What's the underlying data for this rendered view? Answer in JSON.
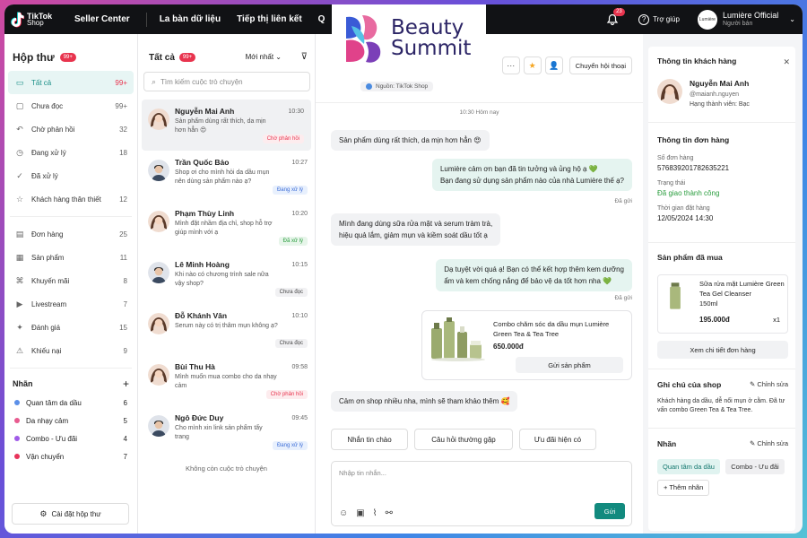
{
  "topbar": {
    "logo_name": "TikTok",
    "logo_sub": "Shop",
    "nav": [
      "Seller Center",
      "La bàn dữ liệu",
      "Tiếp thị liên kết",
      "Q"
    ],
    "notif_count": "23",
    "help_label": "Trợ giúp",
    "user_avatar_text": "Lumière",
    "user_name": "Lumière Official",
    "user_role": "Người bán"
  },
  "brand": {
    "line1": "Beauty",
    "line2": "Summit"
  },
  "sidebar": {
    "title": "Hộp thư",
    "badge": "99+",
    "items": [
      {
        "label": "Tất cả",
        "count": "99+",
        "icon": "inbox-icon"
      },
      {
        "label": "Chưa đọc",
        "count": "99+",
        "icon": "chat-icon"
      },
      {
        "label": "Chờ phản hồi",
        "count": "32",
        "icon": "reply-icon"
      },
      {
        "label": "Đang xử lý",
        "count": "18",
        "icon": "clock-icon"
      },
      {
        "label": "Đã xử lý",
        "count": "",
        "icon": "check-circle-icon"
      },
      {
        "label": "Khách hàng thân thiết",
        "count": "12",
        "icon": "star-icon"
      }
    ],
    "items2": [
      {
        "label": "Đơn hàng",
        "count": "25",
        "icon": "document-icon"
      },
      {
        "label": "Sản phẩm",
        "count": "11",
        "icon": "box-icon"
      },
      {
        "label": "Khuyến mãi",
        "count": "8",
        "icon": "tag-icon"
      },
      {
        "label": "Livestream",
        "count": "7",
        "icon": "video-icon"
      },
      {
        "label": "Đánh giá",
        "count": "15",
        "icon": "review-icon"
      },
      {
        "label": "Khiếu nại",
        "count": "9",
        "icon": "alert-icon"
      }
    ],
    "labels_title": "Nhãn",
    "labels": [
      {
        "label": "Quan tâm da dầu",
        "count": "6",
        "color": "#5b8fe8"
      },
      {
        "label": "Da nhạy cảm",
        "count": "5",
        "color": "#e85b8f"
      },
      {
        "label": "Combo - Ưu đãi",
        "count": "4",
        "color": "#a05be8"
      },
      {
        "label": "Vận chuyển",
        "count": "7",
        "color": "#e8345b"
      }
    ],
    "settings_label": "Cài đặt hộp thư"
  },
  "convlist": {
    "title": "Tất cả",
    "badge": "99+",
    "sort": "Mới nhất",
    "search_placeholder": "Tìm kiếm cuộc trò chuyện",
    "items": [
      {
        "name": "Nguyễn Mai Anh",
        "preview": "Sản phẩm dùng rất thích, da mịn hơn hẳn 😍",
        "time": "10:30",
        "status": "Chờ phản hồi",
        "tone": "red",
        "gender": "f"
      },
      {
        "name": "Trần Quốc Bảo",
        "preview": "Shop ơi cho mình hỏi da dầu mụn nên dùng sản phẩm nào ạ?",
        "time": "10:27",
        "status": "Đang xử lý",
        "tone": "blue",
        "gender": "m"
      },
      {
        "name": "Phạm Thùy Linh",
        "preview": "Mình đặt nhầm địa chỉ, shop hỗ trợ giúp mình với ạ",
        "time": "10:20",
        "status": "Đã xử lý",
        "tone": "green",
        "gender": "f"
      },
      {
        "name": "Lê Minh Hoàng",
        "preview": "Khi nào có chương trình sale nữa vậy shop?",
        "time": "10:15",
        "status": "Chưa đọc",
        "tone": "gray",
        "gender": "m"
      },
      {
        "name": "Đỗ Khánh Vân",
        "preview": "Serum này có trị thâm mụn không ạ?",
        "time": "10:10",
        "status": "Chưa đọc",
        "tone": "gray",
        "gender": "f"
      },
      {
        "name": "Bùi Thu Hà",
        "preview": "Mình muốn mua combo cho da nhạy cảm",
        "time": "09:58",
        "status": "Chờ phản hồi",
        "tone": "red",
        "gender": "f"
      },
      {
        "name": "Ngô Đức Duy",
        "preview": "Cho mình xin link sản phẩm tẩy trang",
        "time": "09:45",
        "status": "Đang xử lý",
        "tone": "blue",
        "gender": "m"
      }
    ],
    "end_text": "Không còn cuộc trò chuyện"
  },
  "chat": {
    "transfer_label": "Chuyển hội thoại",
    "source": "Nguồn: TikTok Shop",
    "timestamp": "10:30 Hôm nay",
    "messages": [
      {
        "dir": "in",
        "text": "Sản phẩm dùng rất thích, da mịn hơn hẳn 😍"
      },
      {
        "dir": "out",
        "text": "Lumière cảm ơn bạn đã tin tưởng và ủng hộ ạ 💚\nBạn đang sử dụng sản phẩm nào của nhà Lumière thế ạ?"
      },
      {
        "dir": "in",
        "text": "Mình đang dùng sữa rửa mặt và serum tràm trà,\nhiệu quả lắm, giảm mụn và kiềm soát dầu tốt ạ"
      },
      {
        "dir": "out",
        "text": "Dạ tuyệt vời quá ạ! Bạn có thể kết hợp thêm kem dưỡng\nẩm và kem chống nắng để bảo vệ da tốt hơn nha 💚"
      },
      {
        "dir": "in",
        "text": "Cảm ơn shop nhiều nha, mình sẽ tham khảo thêm 🥰"
      }
    ],
    "sent_label": "Đã gửi",
    "product": {
      "name": "Combo chăm sóc da dầu mụn Lumière Green Tea & Tea Tree",
      "price": "650.000đ",
      "send_label": "Gửi sản phẩm"
    },
    "quick_replies": [
      "Nhắn tin chào",
      "Câu hỏi thường gặp",
      "Ưu đãi hiện có"
    ],
    "input_placeholder": "Nhập tin nhắn...",
    "send_label": "Gửi"
  },
  "rpanel": {
    "customer_title": "Thông tin khách hàng",
    "customer_name": "Nguyễn Mai Anh",
    "customer_handle": "@maianh.nguyen",
    "customer_tier": "Hạng thành viên: Bạc",
    "order_title": "Thông tin đơn hàng",
    "order_no_label": "Số đơn hàng",
    "order_no": "576839201782635221",
    "status_label": "Trạng thái",
    "status_value": "Đã giao thành công",
    "time_label": "Thời gian đặt hàng",
    "time_value": "12/05/2024 14:30",
    "bought_title": "Sản phẩm đã mua",
    "bought_name": "Sữa rửa mặt Lumière Green Tea Gel Cleanser",
    "bought_size": "150ml",
    "bought_price": "195.000đ",
    "bought_qty": "x1",
    "order_detail_label": "Xem chi tiết đơn hàng",
    "note_title": "Ghi chú của shop",
    "note_edit": "Chỉnh sửa",
    "note_text": "Khách hàng da dầu, dễ nổi mụn ở cằm. Đã tư vấn combo Green Tea & Tea Tree.",
    "tags_title": "Nhãn",
    "tags_edit": "Chỉnh sửa",
    "tags": [
      "Quan tâm da dầu",
      "Combo - Ưu đãi"
    ],
    "add_tag_label": "+ Thêm nhãn"
  }
}
